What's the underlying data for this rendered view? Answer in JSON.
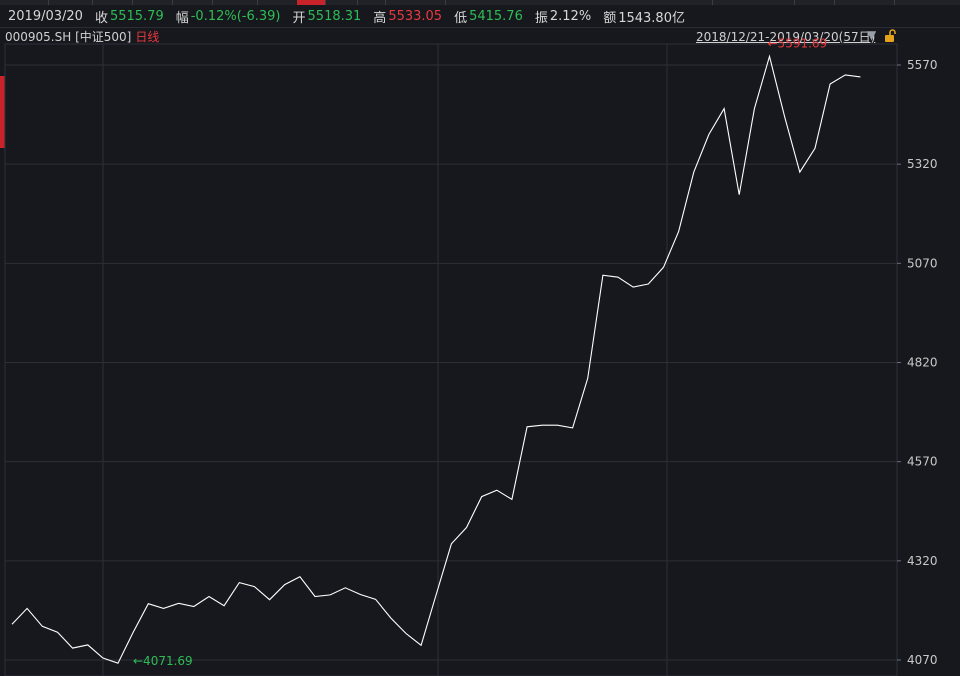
{
  "header": {
    "date": "2019/03/20",
    "close_label": "收",
    "close_value": "5515.79",
    "change_label": "幅",
    "change_value": "-0.12%(-6.39)",
    "open_label": "开",
    "open_value": "5518.31",
    "high_label": "高",
    "high_value": "5533.05",
    "low_label": "低",
    "low_value": "5415.76",
    "amplitude_label": "振",
    "amplitude_value": "2.12%",
    "amount_label": "额",
    "amount_value": "1543.80亿"
  },
  "sub": {
    "code": "000905.SH",
    "name": "[中证500]",
    "period": "日线",
    "range": "2018/12/21-2019/03/20(57日)",
    "dropdown_icon": "triangle-down-icon",
    "lock_icon": "unlock-icon"
  },
  "colors": {
    "up": "#e8393f",
    "down": "#2ebd55",
    "line": "#ffffff",
    "grid": "#2c2f36",
    "background": "#16181d"
  },
  "chart_data": {
    "type": "line",
    "ylim": [
      4070,
      5570
    ],
    "yticks": [
      "5570",
      "5320",
      "5070",
      "4820",
      "4570",
      "4320",
      "4070"
    ],
    "grid": true,
    "values": [
      4160,
      4200,
      4155,
      4140,
      4100,
      4108,
      4075,
      4062,
      4140,
      4212,
      4200,
      4213,
      4205,
      4230,
      4207,
      4265,
      4255,
      4222,
      4260,
      4280,
      4230,
      4234,
      4252,
      4235,
      4223,
      4176,
      4137,
      4107,
      4235,
      4363,
      4404,
      4482,
      4498,
      4475,
      4658,
      4662,
      4662,
      4655,
      4780,
      5040,
      5035,
      5010,
      5018,
      5060,
      5150,
      5300,
      5395,
      5460,
      5243,
      5460,
      5591.69,
      5440,
      5300,
      5360,
      5522,
      5545,
      5540
    ],
    "max_label": "5591.69",
    "min_label": "4071.69"
  }
}
